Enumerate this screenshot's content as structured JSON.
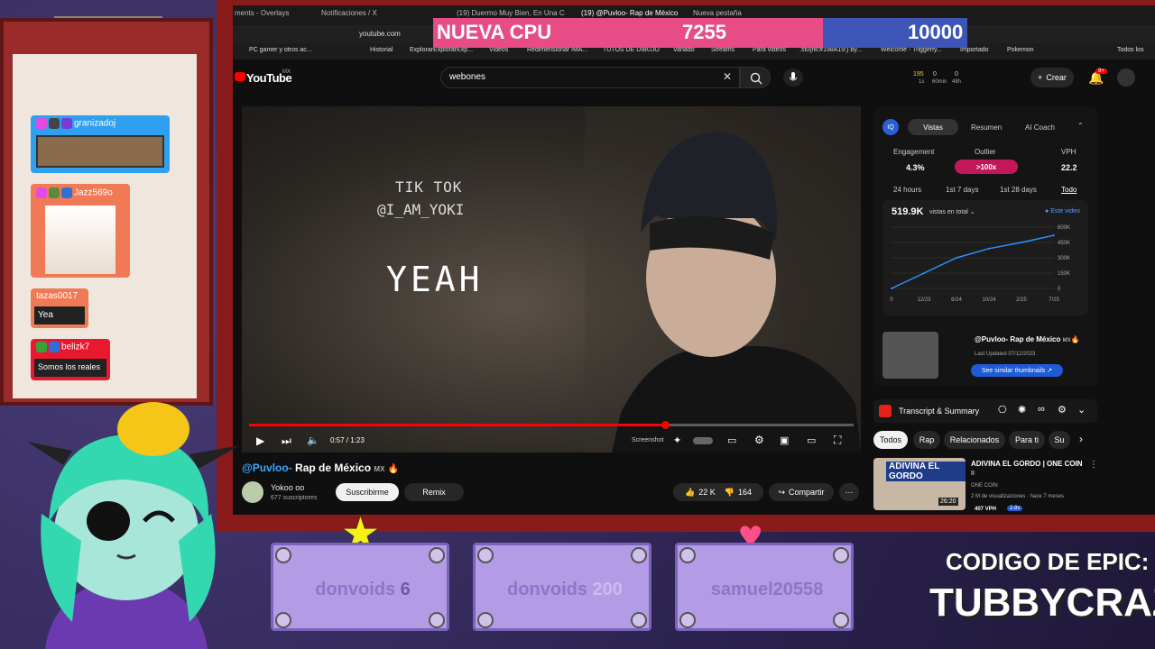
{
  "cpu": {
    "label": "NUEVA CPU",
    "value": "7255",
    "goal": "10000"
  },
  "tabs": [
    {
      "label": "ments - Overlays"
    },
    {
      "label": "Notificaciones / X"
    },
    {
      "label": "(19) Duermo Muy Bien, En Una Cama"
    },
    {
      "label": "(19) @Puvloo- Rap de México"
    },
    {
      "label": "Nueva pestaña"
    }
  ],
  "address": "youtube.com",
  "bookmarks": [
    "Historial",
    "ExplorarExplorarExp...",
    "Videos",
    "Redimensionar IMA...",
    "TUTOS DE DIBUJO",
    "Variado",
    "Streams",
    "Para videos",
    ".st0{fill:#198A19;} by...",
    "Welcome - Triggerfy...",
    "Importado",
    "Pokemon",
    "PC gamer y otros ac...",
    "Todos los"
  ],
  "youtube": {
    "logo": "YouTube",
    "region": "MX",
    "search_value": "webones",
    "create_label": "Crear",
    "notif_count": "9+",
    "header_stats": [
      "195",
      "0",
      "0"
    ],
    "header_stats_labels": [
      "1s",
      "60min",
      "48h"
    ]
  },
  "video": {
    "overlay_line1": "TIK TOK",
    "overlay_line2": "@I_AM_YOKI",
    "overlay_main": "YEAH",
    "time": "0:57 / 1:23",
    "screenshot_label": "Screenshot",
    "progress": 0.69,
    "title_handle": "@Puvloo-",
    "title_rest": " Rap de México",
    "title_mx": "MX",
    "channel": "Yokoo oo",
    "subscribers": "677 suscriptores",
    "subscribe_label": "Suscribirme",
    "remix_label": "Remix",
    "likes": "22 K",
    "dislikes": "164",
    "share_label": "Compartir"
  },
  "iq": {
    "badge": "IQ",
    "tabs": [
      "Vistas",
      "Resumen",
      "AI Coach"
    ],
    "metrics_labels": [
      "Engagement",
      "Outlier",
      "VPH"
    ],
    "metrics_values": [
      "4.3%",
      ">100x",
      "22.2"
    ],
    "ranges": [
      "24 hours",
      "1st 7 days",
      "1st 28 days",
      "Todo"
    ],
    "views_total": "519.9K",
    "views_select": "vistas en total",
    "legend": "Este video",
    "y_ticks": [
      "600K",
      "450K",
      "300K",
      "150K",
      "0"
    ],
    "x_ticks": [
      "0",
      "12/23",
      "6/24",
      "10/24",
      "2/25",
      "7/25"
    ],
    "thumb_title": "@Puvloo- Rap de México",
    "thumb_mx": "MX",
    "last_updated": "Last Updated 07/12/2023",
    "similar_button": "See similar thumbnails"
  },
  "chart_data": {
    "type": "line",
    "x": [
      "0",
      "12/23",
      "6/24",
      "10/24",
      "2/25",
      "7/25"
    ],
    "series": [
      {
        "name": "Este video",
        "values": [
          0,
          150000,
          300000,
          390000,
          450000,
          520000
        ]
      }
    ],
    "ylim": [
      0,
      600000
    ],
    "legend": "top-right"
  },
  "transcript": {
    "label": "Transcript & Summary"
  },
  "chips": [
    "Todos",
    "Rap",
    "Relacionados",
    "Para ti",
    "Su"
  ],
  "recommended": {
    "thumb_text": "ADIVINA EL GORDO",
    "duration": "26:20",
    "title": "ADIVINA EL GORDO | ONE COIN",
    "title_2": "II",
    "channel": "ONE COIN",
    "meta": "2 M de visualizaciones · hace 7 meses",
    "vph": "407 VPH",
    "mult": "2.8x"
  },
  "chat": [
    {
      "user": "granizadoj",
      "text": ""
    },
    {
      "user": "Jazz569o",
      "text": ""
    },
    {
      "user": "tazas0017",
      "text": "Yea"
    },
    {
      "user": "belizk7",
      "text": "Somos los reales"
    }
  ],
  "name_cards": [
    {
      "name": "donvoids",
      "num": "6"
    },
    {
      "name": "donvoids",
      "num": "200"
    },
    {
      "name": "samuel20558",
      "num": ""
    }
  ],
  "epic": {
    "line1": "CODIGO DE EPIC:",
    "line2": "TUBBYCRAZY"
  }
}
